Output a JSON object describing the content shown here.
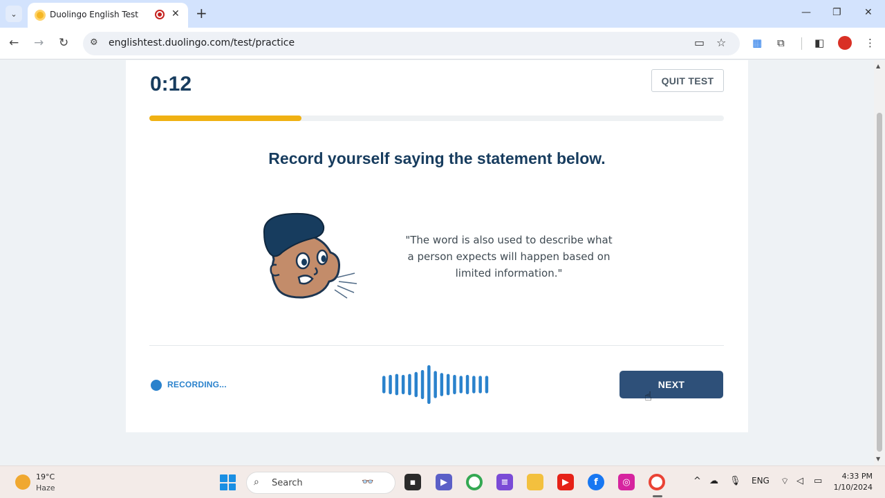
{
  "browser": {
    "tab_title": "Duolingo English Test",
    "url": "englishtest.duolingo.com/test/practice"
  },
  "test": {
    "timer": "0:12",
    "quit_label": "QUIT TEST",
    "progress": 0.265,
    "instruction": "Record yourself saying the statement below.",
    "statement": "\"The word is also used to describe what a person expects will happen based on limited information.\"",
    "recording_label": "RECORDING...",
    "next_label": "NEXT",
    "waveform_levels": [
      0.45,
      0.5,
      0.55,
      0.5,
      0.55,
      0.65,
      0.75,
      1.0,
      0.7,
      0.6,
      0.55,
      0.5,
      0.45,
      0.5,
      0.45,
      0.45,
      0.45
    ],
    "colors": {
      "accent": "#f0b113",
      "primary": "#173c5e",
      "button": "#2e5079",
      "recording": "#2a82cc"
    }
  },
  "taskbar": {
    "weather_temp": "19°C",
    "weather_condition": "Haze",
    "search_label": "Search",
    "language": "ENG",
    "time": "4:33 PM",
    "date": "1/10/2024",
    "apps": [
      "file-explorer",
      "video-call",
      "chrome",
      "media",
      "folder",
      "youtube",
      "facebook",
      "instagram",
      "chrome"
    ]
  }
}
